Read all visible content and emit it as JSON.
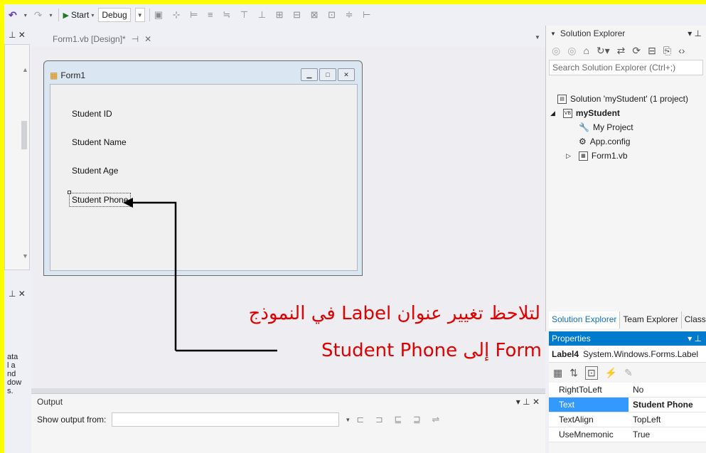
{
  "toolbar": {
    "start_label": "Start",
    "config_value": "Debug"
  },
  "document_tab": {
    "label": "Form1.vb [Design]*",
    "pin": "⊣",
    "close": "✕"
  },
  "form": {
    "title": "Form1",
    "labels": [
      "Student ID",
      "Student Name",
      "Student Age",
      "Student Phone"
    ]
  },
  "solution_explorer": {
    "title": "Solution Explorer",
    "search_placeholder": "Search Solution Explorer (Ctrl+;)",
    "solution": "Solution 'myStudent' (1 project)",
    "project": "myStudent",
    "items": [
      "My Project",
      "App.config",
      "Form1.vb"
    ],
    "bottom_tabs": [
      "Solution Explorer",
      "Team Explorer",
      "Class View"
    ]
  },
  "properties": {
    "title": "Properties",
    "object_name": "Label4",
    "object_type": "System.Windows.Forms.Label",
    "rows": [
      {
        "key": "RightToLeft",
        "value": "No"
      },
      {
        "key": "Text",
        "value": "Student Phone"
      },
      {
        "key": "TextAlign",
        "value": "TopLeft"
      },
      {
        "key": "UseMnemonic",
        "value": "True"
      }
    ]
  },
  "output": {
    "title": "Output",
    "show_from_label": "Show output from:"
  },
  "left_panel_text": [
    "ata",
    "l a",
    "nd",
    "dow",
    "s."
  ],
  "annotation": {
    "line1": "لتلاحظ تغيير عنوان Label في النموذج",
    "line2": "Form إلى Student Phone"
  },
  "colors": {
    "annotation_red": "#e00000",
    "frame_yellow": "#ffff00",
    "accent_blue": "#007acc"
  }
}
